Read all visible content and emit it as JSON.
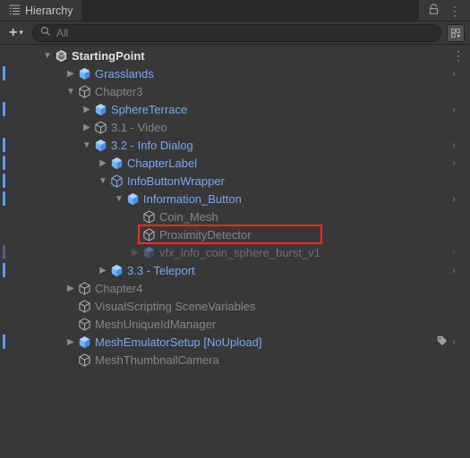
{
  "panel": {
    "title": "Hierarchy"
  },
  "search": {
    "placeholder": "All"
  },
  "root": {
    "label": "StartingPoint"
  },
  "rows": {
    "grasslands": "Grasslands",
    "chapter3": "Chapter3",
    "sphereTerrace": "SphereTerrace",
    "video31": "3.1 - Video",
    "info32": "3.2 - Info Dialog",
    "chapterLabel": "ChapterLabel",
    "infoButtonWrapper": "InfoButtonWrapper",
    "informationButton": "Information_Button",
    "coinMesh": "Coin_Mesh",
    "proximityDetector": "ProximityDetector",
    "vfx": "vfx_info_coin_sphere_burst_v1",
    "teleport33": "3.3 - Teleport",
    "chapter4": "Chapter4",
    "vsVars": "VisualScripting SceneVariables",
    "meshUid": "MeshUniqueIdManager",
    "emuSetup": "MeshEmulatorSetup [NoUpload]",
    "thumbCam": "MeshThumbnailCamera"
  }
}
